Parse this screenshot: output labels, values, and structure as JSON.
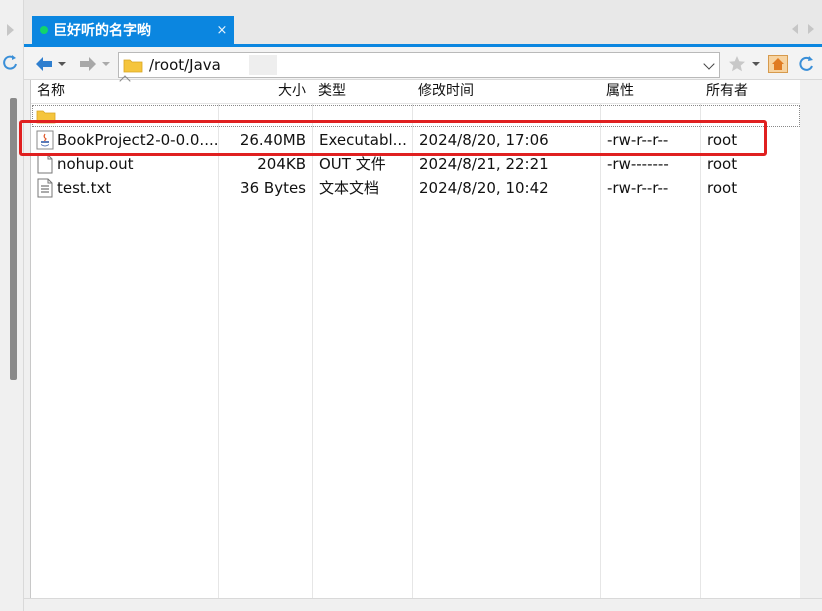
{
  "tab": {
    "title": "巨好听的名字哟",
    "close": "×",
    "status_color": "#12d46b"
  },
  "toolbar": {
    "path_value": "/root/Java"
  },
  "columns": {
    "name": "名称",
    "size": "大小",
    "type": "类型",
    "modified": "修改时间",
    "attrs": "属性",
    "owner": "所有者"
  },
  "files": [
    {
      "name": "BookProject2-0-0.0....",
      "size": "26.40MB",
      "type": "Executabl...",
      "modified": "2024/8/20, 17:06",
      "attrs": "-rw-r--r--",
      "owner": "root",
      "icon": "java-jar-icon"
    },
    {
      "name": "nohup.out",
      "size": "204KB",
      "type": "OUT 文件",
      "modified": "2024/8/21, 22:21",
      "attrs": "-rw-------",
      "owner": "root",
      "icon": "file-icon"
    },
    {
      "name": "test.txt",
      "size": "36 Bytes",
      "type": "文本文档",
      "modified": "2024/8/20, 10:42",
      "attrs": "-rw-r--r--",
      "owner": "root",
      "icon": "text-file-icon"
    }
  ],
  "colors": {
    "accent": "#0b86e0",
    "highlight": "#e02020"
  }
}
